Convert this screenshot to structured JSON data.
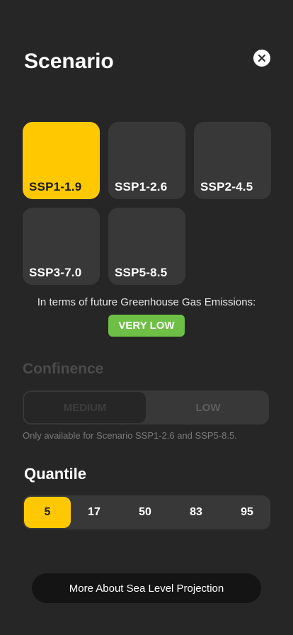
{
  "header": {
    "title": "Scenario",
    "close_icon": "close-icon"
  },
  "scenarios": {
    "selected": "SSP1-1.9",
    "items": [
      {
        "label": "SSP1-1.9"
      },
      {
        "label": "SSP1-2.6"
      },
      {
        "label": "SSP2-4.5"
      },
      {
        "label": "SSP3-7.0"
      },
      {
        "label": "SSP5-8.5"
      }
    ]
  },
  "emissions": {
    "text": "In terms of future Greenhouse Gas Emissions:",
    "level": "VERY LOW",
    "level_color": "#6ebf45"
  },
  "confinence": {
    "title": "Confinence",
    "options": [
      "MEDIUM",
      "LOW"
    ],
    "selected": "MEDIUM",
    "disabled": true,
    "note": "Only available for Scenario SSP1-2.6 and SSP5-8.5."
  },
  "quantile": {
    "title": "Quantile",
    "options": [
      "5",
      "17",
      "50",
      "83",
      "95"
    ],
    "selected": "5"
  },
  "footer": {
    "more_button": "More About Sea Level Projection"
  },
  "colors": {
    "background": "#262626",
    "accent": "#ffc800",
    "tile": "#383838"
  }
}
